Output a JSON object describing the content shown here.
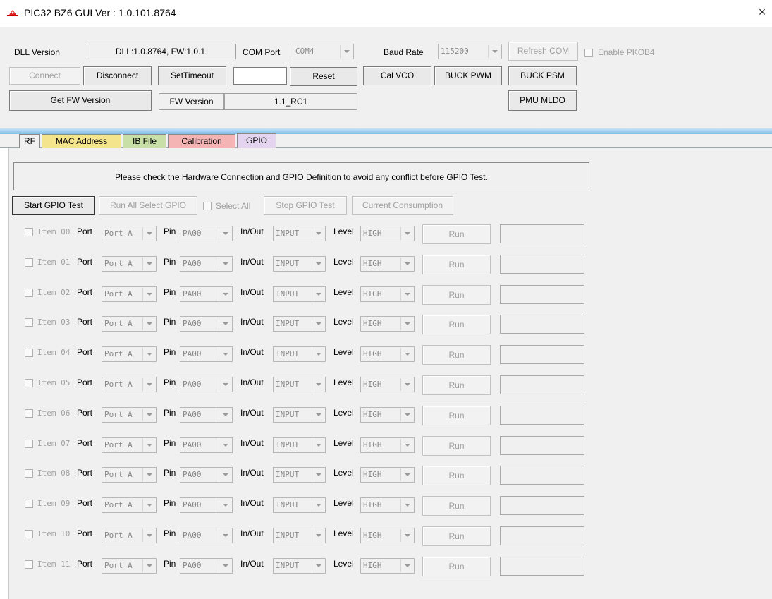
{
  "window": {
    "title": "PIC32 BZ6 GUI Ver : 1.0.101.8764",
    "close_symbol": "×"
  },
  "header": {
    "dll_label": "DLL Version",
    "dll_value": "DLL:1.0.8764, FW:1.0.1",
    "com_label": "COM Port",
    "com_value": "COM4",
    "baud_label": "Baud Rate",
    "baud_value": "115200",
    "refresh_com": "Refresh COM",
    "enable_pkob4": "Enable PKOB4",
    "connect": "Connect",
    "disconnect": "Disconnect",
    "set_timeout": "SetTimeout",
    "timeout_value": "",
    "reset": "Reset",
    "cal_vco": "Cal VCO",
    "buck_pwm": "BUCK PWM",
    "buck_psm": "BUCK PSM",
    "get_fw": "Get FW Version",
    "fw_label": "FW Version",
    "fw_value": "1.1_RC1",
    "pmu_mldo": "PMU MLDO"
  },
  "tabs": [
    {
      "label": "RF",
      "color": "#f0f0f0"
    },
    {
      "label": "MAC Address",
      "color": "#f4e48c"
    },
    {
      "label": "IB File",
      "color": "#c8e0a8"
    },
    {
      "label": "Calibration",
      "color": "#f4b4b4"
    },
    {
      "label": "GPIO",
      "color": "#e4d4f0"
    }
  ],
  "gpio": {
    "notice": "Please check the Hardware Connection and GPIO Definition to avoid any conflict before GPIO Test.",
    "start_test": "Start GPIO Test",
    "run_all": "Run All Select GPIO",
    "select_all": "Select All",
    "stop_test": "Stop GPIO Test",
    "current": "Current Consumption",
    "port_label": "Port",
    "pin_label": "Pin",
    "inout_label": "In/Out",
    "level_label": "Level",
    "run_label": "Run",
    "items": [
      {
        "item": "Item 00",
        "port": "Port A",
        "pin": "PA00",
        "dir": "INPUT",
        "level": "HIGH"
      },
      {
        "item": "Item 01",
        "port": "Port A",
        "pin": "PA00",
        "dir": "INPUT",
        "level": "HIGH"
      },
      {
        "item": "Item 02",
        "port": "Port A",
        "pin": "PA00",
        "dir": "INPUT",
        "level": "HIGH"
      },
      {
        "item": "Item 03",
        "port": "Port A",
        "pin": "PA00",
        "dir": "INPUT",
        "level": "HIGH"
      },
      {
        "item": "Item 04",
        "port": "Port A",
        "pin": "PA00",
        "dir": "INPUT",
        "level": "HIGH"
      },
      {
        "item": "Item 05",
        "port": "Port A",
        "pin": "PA00",
        "dir": "INPUT",
        "level": "HIGH"
      },
      {
        "item": "Item 06",
        "port": "Port A",
        "pin": "PA00",
        "dir": "INPUT",
        "level": "HIGH"
      },
      {
        "item": "Item 07",
        "port": "Port A",
        "pin": "PA00",
        "dir": "INPUT",
        "level": "HIGH"
      },
      {
        "item": "Item 08",
        "port": "Port A",
        "pin": "PA00",
        "dir": "INPUT",
        "level": "HIGH"
      },
      {
        "item": "Item 09",
        "port": "Port A",
        "pin": "PA00",
        "dir": "INPUT",
        "level": "HIGH"
      },
      {
        "item": "Item 10",
        "port": "Port A",
        "pin": "PA00",
        "dir": "INPUT",
        "level": "HIGH"
      },
      {
        "item": "Item 11",
        "port": "Port A",
        "pin": "PA00",
        "dir": "INPUT",
        "level": "HIGH"
      }
    ]
  }
}
